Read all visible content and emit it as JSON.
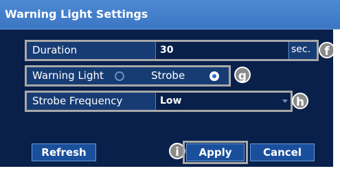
{
  "dialog": {
    "title": "Warning Light Settings"
  },
  "duration": {
    "label": "Duration",
    "value": "30",
    "unit": "sec.",
    "callout": "f"
  },
  "warning_light": {
    "label": "Warning Light",
    "option_label": "Strobe",
    "unselected_radio": "radio-off",
    "selected_radio": "radio-on",
    "callout": "g"
  },
  "strobe_frequency": {
    "label": "Strobe Frequency",
    "value": "Low",
    "callout": "h"
  },
  "buttons": {
    "refresh": "Refresh",
    "apply": "Apply",
    "cancel": "Cancel",
    "apply_callout": "i"
  },
  "colors": {
    "background": "#08204a",
    "titlebar": "#3b76c4",
    "row": "#173c74",
    "highlight_frame": "#a9a9a9",
    "button": "#1a4f9c",
    "radio_selected": "#2a6fd6"
  }
}
